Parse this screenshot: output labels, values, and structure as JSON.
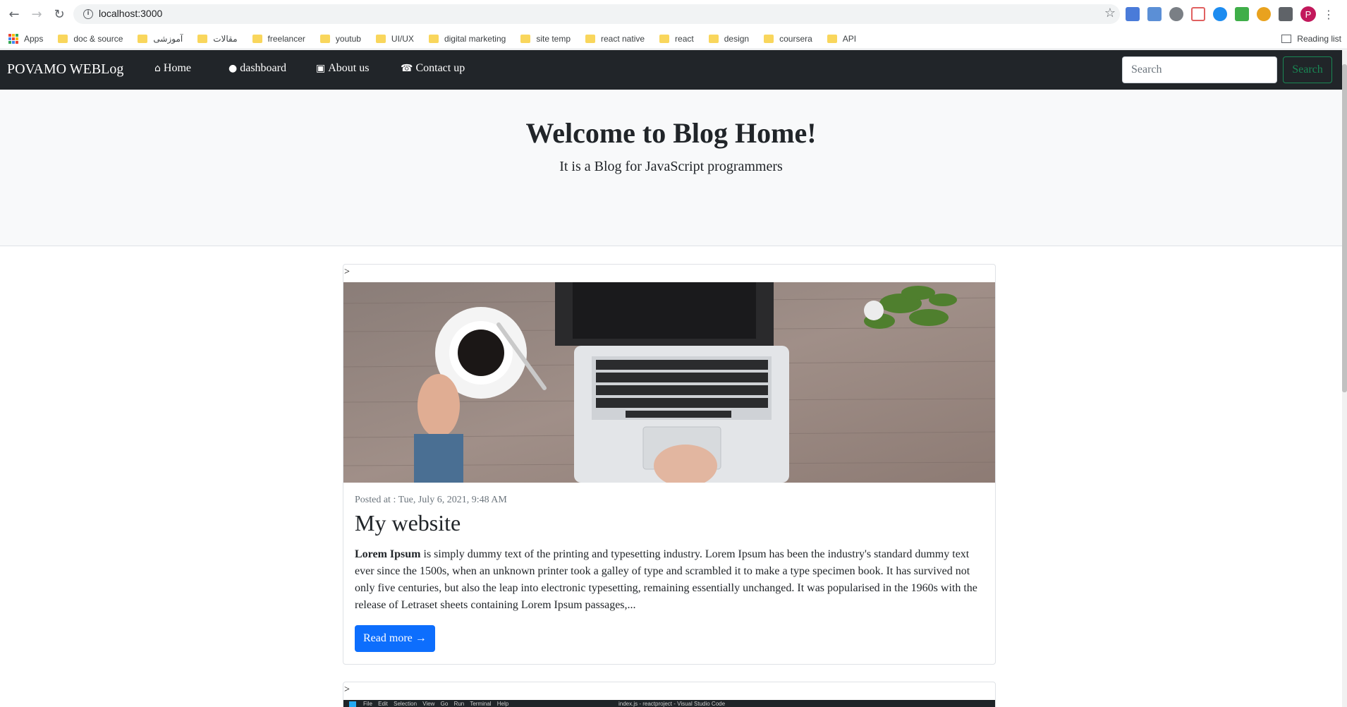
{
  "browser": {
    "url": "localhost:3000",
    "bookmarks": [
      "Apps",
      "doc & source",
      "آموزشی",
      "مقالات",
      "freelancer",
      "youtub",
      "UI/UX",
      "digital marketing",
      "site temp",
      "react native",
      "react",
      "design",
      "coursera",
      "API"
    ],
    "reading_list": "Reading list",
    "profile_initial": "P"
  },
  "navbar": {
    "brand": "POVAMO WEBLog",
    "links": [
      "Home",
      "dashboard",
      "About us",
      "Contact up"
    ],
    "search_placeholder": "Search",
    "search_button": "Search"
  },
  "hero": {
    "title": "Welcome to Blog Home!",
    "subtitle": "It is a Blog for JavaScript programmers"
  },
  "posts": [
    {
      "caret": ">",
      "posted_at": "Posted at : Tue, July 6, 2021, 9:48 AM",
      "title": "My website",
      "lead_bold": "Lorem Ipsum",
      "body": " is simply dummy text of the printing and typesetting industry. Lorem Ipsum has been the industry's standard dummy text ever since the 1500s, when an unknown printer took a galley of type and scrambled it to make a type specimen book. It has survived not only five centuries, but also the leap into electronic typesetting, remaining essentially unchanged. It was popularised in the 1960s with the release of Letraset sheets containing Lorem Ipsum passages,...",
      "read_more": "Read more →"
    },
    {
      "caret": ">",
      "editor_menu": "File Edit Selection View Go Run Terminal Help",
      "editor_title": "index.js - reactproject - Visual Studio Code"
    }
  ],
  "colors": {
    "navbar_bg": "#212529",
    "primary": "#0d6efd",
    "success": "#198754",
    "hero_bg": "#f8f9fa"
  },
  "icons": {
    "home": "home-icon",
    "dashboard": "balloon-icon",
    "about": "id-card-icon",
    "contact": "phone-icon"
  }
}
